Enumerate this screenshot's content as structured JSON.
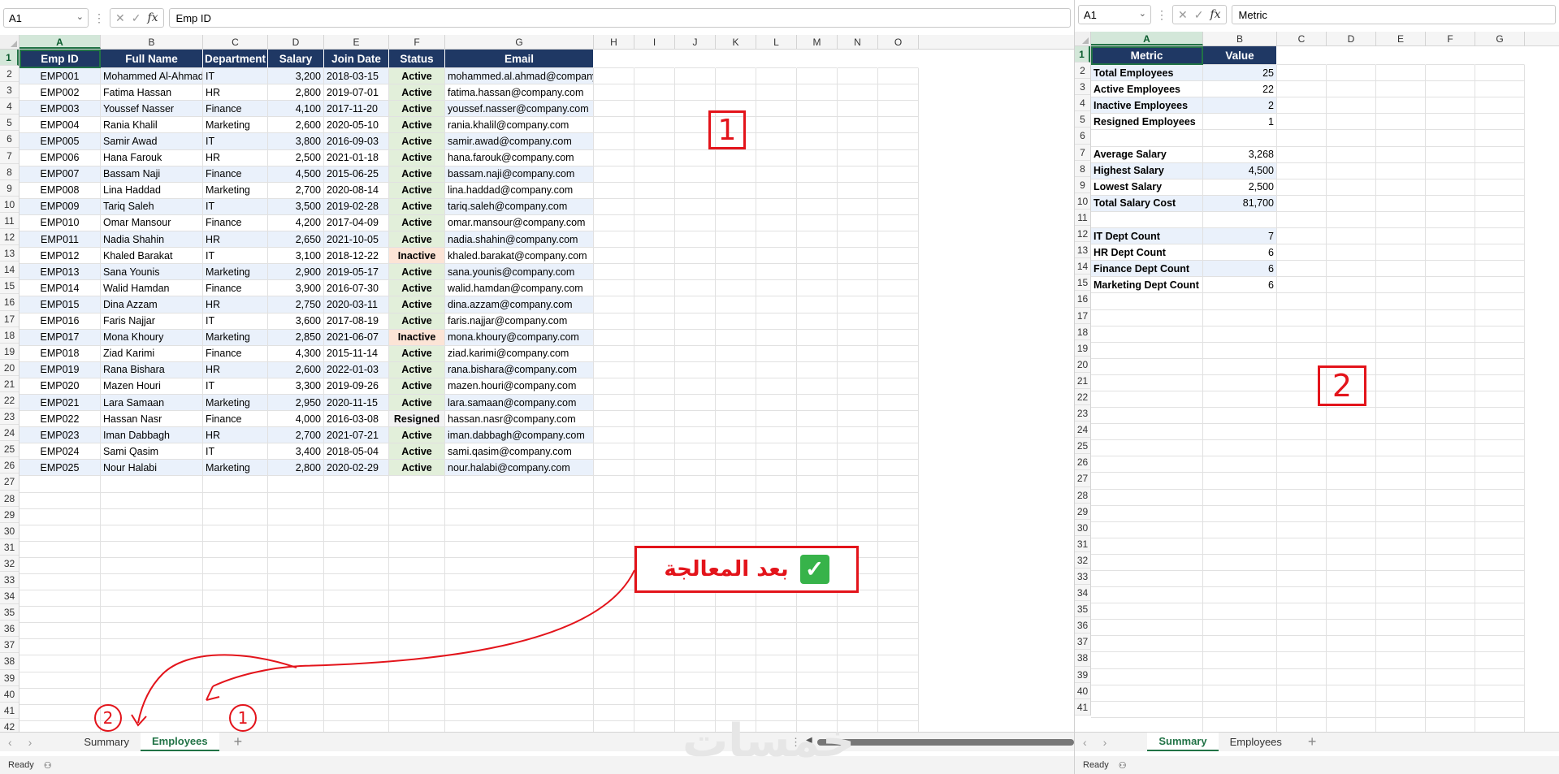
{
  "left": {
    "namebox": "A1",
    "formula": "Emp ID",
    "columns": [
      "A",
      "B",
      "C",
      "D",
      "E",
      "F",
      "G",
      "H",
      "I",
      "J",
      "K",
      "L",
      "M",
      "N",
      "O"
    ],
    "row_numbers": [
      "1",
      "2",
      "3",
      "4",
      "5",
      "6",
      "7",
      "8",
      "9",
      "10",
      "11",
      "12",
      "13",
      "14",
      "15",
      "16",
      "17",
      "18",
      "19",
      "20",
      "21",
      "22",
      "23",
      "24",
      "25",
      "26",
      "27",
      "28",
      "29",
      "30",
      "31",
      "32",
      "33",
      "34",
      "35",
      "36",
      "37",
      "38",
      "39",
      "40",
      "41",
      "42"
    ],
    "headers": [
      "Emp ID",
      "Full Name",
      "Department",
      "Salary",
      "Join Date",
      "Status",
      "Email"
    ],
    "rows": [
      [
        "EMP001",
        "Mohammed Al-Ahmad",
        "IT",
        "3,200",
        "2018-03-15",
        "Active",
        "mohammed.al.ahmad@company.com"
      ],
      [
        "EMP002",
        "Fatima Hassan",
        "HR",
        "2,800",
        "2019-07-01",
        "Active",
        "fatima.hassan@company.com"
      ],
      [
        "EMP003",
        "Youssef Nasser",
        "Finance",
        "4,100",
        "2017-11-20",
        "Active",
        "youssef.nasser@company.com"
      ],
      [
        "EMP004",
        "Rania Khalil",
        "Marketing",
        "2,600",
        "2020-05-10",
        "Active",
        "rania.khalil@company.com"
      ],
      [
        "EMP005",
        "Samir Awad",
        "IT",
        "3,800",
        "2016-09-03",
        "Active",
        "samir.awad@company.com"
      ],
      [
        "EMP006",
        "Hana Farouk",
        "HR",
        "2,500",
        "2021-01-18",
        "Active",
        "hana.farouk@company.com"
      ],
      [
        "EMP007",
        "Bassam Naji",
        "Finance",
        "4,500",
        "2015-06-25",
        "Active",
        "bassam.naji@company.com"
      ],
      [
        "EMP008",
        "Lina Haddad",
        "Marketing",
        "2,700",
        "2020-08-14",
        "Active",
        "lina.haddad@company.com"
      ],
      [
        "EMP009",
        "Tariq Saleh",
        "IT",
        "3,500",
        "2019-02-28",
        "Active",
        "tariq.saleh@company.com"
      ],
      [
        "EMP010",
        "Omar Mansour",
        "Finance",
        "4,200",
        "2017-04-09",
        "Active",
        "omar.mansour@company.com"
      ],
      [
        "EMP011",
        "Nadia Shahin",
        "HR",
        "2,650",
        "2021-10-05",
        "Active",
        "nadia.shahin@company.com"
      ],
      [
        "EMP012",
        "Khaled Barakat",
        "IT",
        "3,100",
        "2018-12-22",
        "Inactive",
        "khaled.barakat@company.com"
      ],
      [
        "EMP013",
        "Sana Younis",
        "Marketing",
        "2,900",
        "2019-05-17",
        "Active",
        "sana.younis@company.com"
      ],
      [
        "EMP014",
        "Walid Hamdan",
        "Finance",
        "3,900",
        "2016-07-30",
        "Active",
        "walid.hamdan@company.com"
      ],
      [
        "EMP015",
        "Dina Azzam",
        "HR",
        "2,750",
        "2020-03-11",
        "Active",
        "dina.azzam@company.com"
      ],
      [
        "EMP016",
        "Faris Najjar",
        "IT",
        "3,600",
        "2017-08-19",
        "Active",
        "faris.najjar@company.com"
      ],
      [
        "EMP017",
        "Mona Khoury",
        "Marketing",
        "2,850",
        "2021-06-07",
        "Inactive",
        "mona.khoury@company.com"
      ],
      [
        "EMP018",
        "Ziad Karimi",
        "Finance",
        "4,300",
        "2015-11-14",
        "Active",
        "ziad.karimi@company.com"
      ],
      [
        "EMP019",
        "Rana Bishara",
        "HR",
        "2,600",
        "2022-01-03",
        "Active",
        "rana.bishara@company.com"
      ],
      [
        "EMP020",
        "Mazen Houri",
        "IT",
        "3,300",
        "2019-09-26",
        "Active",
        "mazen.houri@company.com"
      ],
      [
        "EMP021",
        "Lara Samaan",
        "Marketing",
        "2,950",
        "2020-11-15",
        "Active",
        "lara.samaan@company.com"
      ],
      [
        "EMP022",
        "Hassan Nasr",
        "Finance",
        "4,000",
        "2016-03-08",
        "Resigned",
        "hassan.nasr@company.com"
      ],
      [
        "EMP023",
        "Iman Dabbagh",
        "HR",
        "2,700",
        "2021-07-21",
        "Active",
        "iman.dabbagh@company.com"
      ],
      [
        "EMP024",
        "Sami Qasim",
        "IT",
        "3,400",
        "2018-05-04",
        "Active",
        "sami.qasim@company.com"
      ],
      [
        "EMP025",
        "Nour Halabi",
        "Marketing",
        "2,800",
        "2020-02-29",
        "Active",
        "nour.halabi@company.com"
      ]
    ],
    "tabs": [
      {
        "label": "Summary",
        "active": false
      },
      {
        "label": "Employees",
        "active": true
      }
    ],
    "status": "Ready"
  },
  "right": {
    "namebox": "A1",
    "formula": "Metric",
    "columns": [
      "A",
      "B",
      "C",
      "D",
      "E",
      "F",
      "G"
    ],
    "row_numbers": [
      "1",
      "2",
      "3",
      "4",
      "5",
      "6",
      "7",
      "8",
      "9",
      "10",
      "11",
      "12",
      "13",
      "14",
      "15",
      "16",
      "17",
      "18",
      "19",
      "20",
      "21",
      "22",
      "23",
      "24",
      "25",
      "26",
      "27",
      "28",
      "29",
      "30",
      "31",
      "32",
      "33",
      "34",
      "35",
      "36",
      "37",
      "38",
      "39",
      "40",
      "41"
    ],
    "headers": [
      "Metric",
      "Value"
    ],
    "rows": [
      [
        "Total Employees",
        "25"
      ],
      [
        "Active Employees",
        "22"
      ],
      [
        "Inactive Employees",
        "2"
      ],
      [
        "Resigned Employees",
        "1"
      ],
      [
        "",
        ""
      ],
      [
        "Average Salary",
        "3,268"
      ],
      [
        "Highest Salary",
        "4,500"
      ],
      [
        "Lowest Salary",
        "2,500"
      ],
      [
        "Total Salary Cost",
        "81,700"
      ],
      [
        "",
        ""
      ],
      [
        "IT Dept Count",
        "7"
      ],
      [
        "HR Dept Count",
        "6"
      ],
      [
        "Finance Dept Count",
        "6"
      ],
      [
        "Marketing Dept Count",
        "6"
      ]
    ],
    "tabs": [
      {
        "label": "Summary",
        "active": true
      },
      {
        "label": "Employees",
        "active": false
      }
    ],
    "status": "Ready"
  },
  "annotations": {
    "callout_text": "بعد المعالجة",
    "num1": "1",
    "num2": "2",
    "small1": "1",
    "small2": "2",
    "watermark": "خمسات"
  },
  "colors": {
    "header_bg": "#1f3864",
    "alt_row": "#eaf1fb",
    "active": "#e2efda",
    "inactive": "#fce4d6",
    "accent": "#217346",
    "annotation": "#e3141b"
  }
}
